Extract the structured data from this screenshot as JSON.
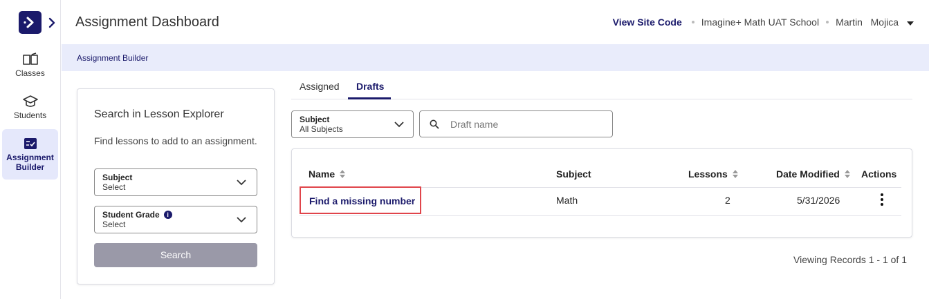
{
  "app": {
    "title": "Assignment Dashboard"
  },
  "topnav": {
    "site_code": "View Site Code",
    "school": "Imagine+ Math UAT School",
    "user_first": "Martin",
    "user_last": "Mojica"
  },
  "rail": {
    "items": [
      {
        "label": "Classes",
        "icon": "book-icon"
      },
      {
        "label": "Students",
        "icon": "graduation-cap-icon"
      },
      {
        "label": "Assignment Builder",
        "icon": "checklist-icon",
        "active": true
      }
    ]
  },
  "breadcrumb": {
    "current": "Assignment Builder"
  },
  "explorer": {
    "title": "Search in Lesson Explorer",
    "description": "Find lessons to add to an assignment.",
    "subject": {
      "label": "Subject",
      "value": "Select"
    },
    "grade": {
      "label": "Student Grade",
      "value": "Select",
      "info": "i"
    },
    "search_label": "Search"
  },
  "tabs": [
    {
      "label": "Assigned",
      "active": false
    },
    {
      "label": "Drafts",
      "active": true
    }
  ],
  "filters": {
    "subject": {
      "label": "Subject",
      "value": "All Subjects"
    },
    "draft_search": {
      "placeholder": "Draft name"
    }
  },
  "table": {
    "columns": {
      "name": "Name",
      "subject": "Subject",
      "lessons": "Lessons",
      "date": "Date Modified",
      "actions": "Actions"
    },
    "rows": [
      {
        "name": "Find a missing number",
        "subject": "Math",
        "lessons": "2",
        "date": "5/31/2026"
      }
    ]
  },
  "pagination": {
    "text": "Viewing Records 1 - 1 of 1"
  },
  "colors": {
    "brand": "#1b1a6b",
    "highlight": "#e0454b",
    "breadcrumb_bg": "#e9ecfb",
    "disabled_button": "#9a99a8"
  }
}
